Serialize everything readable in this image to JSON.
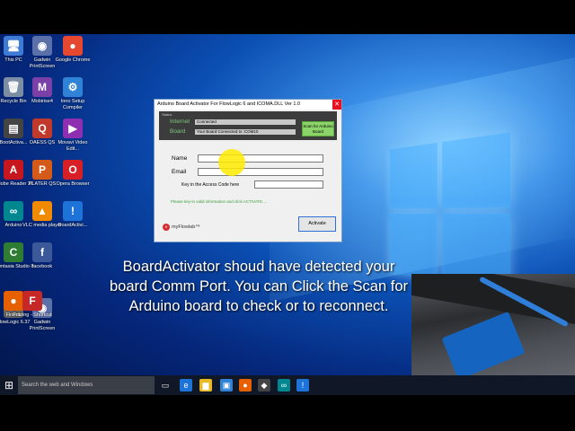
{
  "desktop": {
    "icons": [
      {
        "label": "This PC",
        "glyph": "🖥",
        "color": "#3d7bd4"
      },
      {
        "label": "Gadwin PrintScreen",
        "glyph": "◉",
        "color": "#5b6fa8"
      },
      {
        "label": "Google Chrome",
        "glyph": "●",
        "color": "#e5482f"
      },
      {
        "label": "Recycle Bin",
        "glyph": "🗑",
        "color": "#7c8ea3"
      },
      {
        "label": "Mobirise4",
        "glyph": "M",
        "color": "#7b3fa8"
      },
      {
        "label": "Inno Setup Compiler",
        "glyph": "⚙",
        "color": "#2f82d6"
      },
      {
        "label": "BootActiva...",
        "glyph": "▤",
        "color": "#444"
      },
      {
        "label": "OAESS QS",
        "glyph": "Q",
        "color": "#c0392b"
      },
      {
        "label": "Movavi Video Edit...",
        "glyph": "▶",
        "color": "#8d2fb0"
      },
      {
        "label": "Adobe Reader XI",
        "glyph": "A",
        "color": "#c7161d"
      },
      {
        "label": "PLATER QS",
        "glyph": "P",
        "color": "#d45a1a"
      },
      {
        "label": "Opera Browser",
        "glyph": "O",
        "color": "#d81f26"
      },
      {
        "label": "Arduino",
        "glyph": "∞",
        "color": "#00878f"
      },
      {
        "label": "VLC media player",
        "glyph": "▲",
        "color": "#f08a00"
      },
      {
        "label": "BoardActivi...",
        "glyph": "!",
        "color": "#1e73d8"
      },
      {
        "label": "Camtasia Studio 8",
        "glyph": "C",
        "color": "#2e7d32"
      },
      {
        "label": "facebook",
        "glyph": "f",
        "color": "#3b5998"
      },
      {
        "label": "Firefox",
        "glyph": "●",
        "color": "#e66000"
      },
      {
        "label": "Fritzing - Shortcut",
        "glyph": "F",
        "color": "#c62828"
      },
      {
        "label": "FlowLogic 6.37",
        "glyph": "≡",
        "color": "#666"
      },
      {
        "label": "Gadwin PrintScreen",
        "glyph": "◉",
        "color": "#5b6fa8"
      }
    ]
  },
  "dialog": {
    "title": "Arduino Board Activator For FlowLogic 6 and ICOMA.DLL Ver 1.0",
    "close_glyph": "✕",
    "status_label": "Status",
    "internet_label": "Internet",
    "internet_value": "Connected",
    "board_label": "Board",
    "board_value": "Your Board Connected to :COM10",
    "scan_button": "Scan for Arduino Board",
    "name_label": "Name",
    "name_value": "",
    "email_label": "Email",
    "email_value": "",
    "access_code_label": "Key in the Access Code here",
    "access_code_value": "",
    "hint": "Please key-in valid information and click ACTIVATE....",
    "logo_text": "myFlowlab™",
    "logo_mark": "fl",
    "activate_button": "Activate"
  },
  "caption": "BoardActivator shoud have detected your board Comm Port. You can Click the Scan for Arduino board to check or to reconnect.",
  "taskbar": {
    "start_glyph": "⊞",
    "search_placeholder": "Search the web and Windows",
    "apps": [
      {
        "name": "task-view-icon",
        "glyph": "▭",
        "color": "#101827"
      },
      {
        "name": "edge-icon",
        "glyph": "e",
        "color": "#1e73d8"
      },
      {
        "name": "file-explorer-icon",
        "glyph": "▆",
        "color": "#e8b923"
      },
      {
        "name": "store-icon",
        "glyph": "▣",
        "color": "#2f82d6"
      },
      {
        "name": "firefox-icon",
        "glyph": "●",
        "color": "#e66000"
      },
      {
        "name": "inkscape-icon",
        "glyph": "◆",
        "color": "#444"
      },
      {
        "name": "arduino-icon",
        "glyph": "∞",
        "color": "#00878f"
      },
      {
        "name": "boardactivator-icon",
        "glyph": "!",
        "color": "#1e73d8"
      }
    ]
  }
}
